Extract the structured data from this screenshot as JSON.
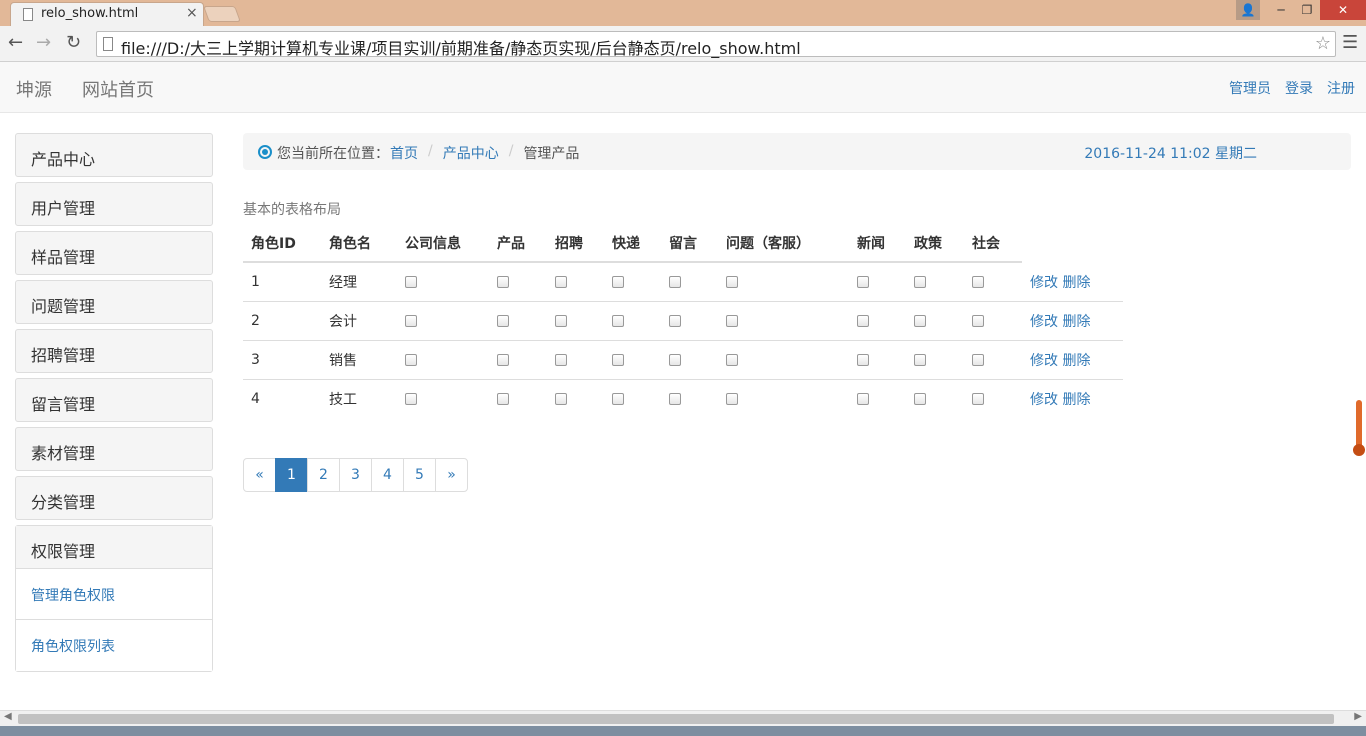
{
  "browser": {
    "tab_title": "relo_show.html",
    "tab_close": "×",
    "url": "file:///D:/大三上学期计算机专业课/项目实训/前期准备/静态页实现/后台静态页/relo_show.html",
    "back_icon": "←",
    "forward_icon": "→",
    "reload_icon": "↻",
    "star_icon": "☆",
    "menu_icon": "☰",
    "min_icon": "─",
    "max_icon": "❐",
    "close_icon": "✕",
    "user_icon": "👤"
  },
  "navbar": {
    "brand": "坤源",
    "home": "网站首页",
    "right_links": [
      "管理员",
      "登录",
      "注册"
    ]
  },
  "sidebar": {
    "items": [
      "产品中心",
      "用户管理",
      "样品管理",
      "问题管理",
      "招聘管理",
      "留言管理",
      "素材管理",
      "分类管理"
    ],
    "group": {
      "label": "权限管理",
      "subitems": [
        "管理角色权限",
        "角色权限列表"
      ]
    }
  },
  "breadcrumb": {
    "location_label": "您当前所在位置：",
    "links": [
      "首页",
      "产品中心"
    ],
    "separator": "/",
    "current": "管理产品",
    "datetime": "2016-11-24 11:02 星期二"
  },
  "caption": "基本的表格布局",
  "table": {
    "headers": [
      "角色ID",
      "角色名",
      "公司信息",
      "产品",
      "招聘",
      "快递",
      "留言",
      "问题（客服）",
      "新闻",
      "政策",
      "社会"
    ],
    "rows": [
      {
        "id": "1",
        "name": "经理"
      },
      {
        "id": "2",
        "name": "会计"
      },
      {
        "id": "3",
        "name": "销售"
      },
      {
        "id": "4",
        "name": "技工"
      }
    ],
    "edit_label": "修改",
    "delete_label": "删除"
  },
  "pagination": {
    "prev": "«",
    "pages": [
      "1",
      "2",
      "3",
      "4",
      "5"
    ],
    "next": "»",
    "active": "1"
  },
  "colors": {
    "link": "#337ab7",
    "titlebar": "#e2b898"
  }
}
